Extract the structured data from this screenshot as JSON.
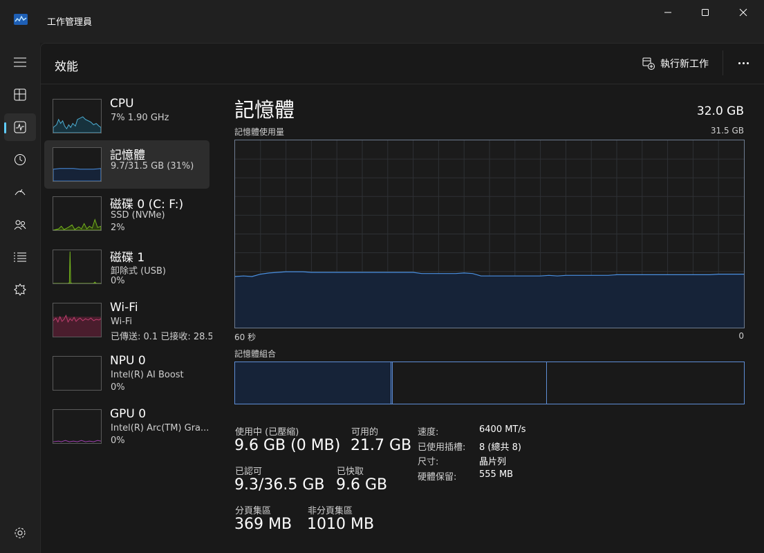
{
  "window": {
    "title": "工作管理員"
  },
  "header": {
    "title": "效能",
    "run_task_label": "執行新工作"
  },
  "nav": {
    "items": [
      {
        "name": "menu",
        "icon": "hamburger-icon"
      },
      {
        "name": "processes",
        "icon": "processes-icon"
      },
      {
        "name": "performance",
        "icon": "performance-icon",
        "active": true
      },
      {
        "name": "app-history",
        "icon": "history-icon"
      },
      {
        "name": "startup-apps",
        "icon": "startup-icon"
      },
      {
        "name": "users",
        "icon": "users-icon"
      },
      {
        "name": "details",
        "icon": "details-icon"
      },
      {
        "name": "services",
        "icon": "services-icon"
      },
      {
        "name": "settings",
        "icon": "settings-icon"
      }
    ]
  },
  "resources": [
    {
      "name": "CPU",
      "line1": "7%  1.90 GHz",
      "line2": "",
      "color": "#4fb3d9"
    },
    {
      "name": "記憶體",
      "line1": "9.7/31.5 GB (31%)",
      "line2": "",
      "color": "#4a7ebf",
      "selected": true
    },
    {
      "name": "磁碟 0 (C: F:)",
      "line1": "SSD (NVMe)",
      "line2": "2%",
      "color": "#77b81e"
    },
    {
      "name": "磁碟 1",
      "line1": "卸除式 (USB)",
      "line2": "0%",
      "color": "#77b81e"
    },
    {
      "name": "Wi-Fi",
      "line1": "Wi-Fi",
      "line2": "已傳送: 0.1  已接收: 28.5",
      "color": "#c04070"
    },
    {
      "name": "NPU 0",
      "line1": "Intel(R) AI Boost",
      "line2": "0%",
      "color": "#4fb3d9"
    },
    {
      "name": "GPU 0",
      "line1": "Intel(R) Arc(TM) Gra...",
      "line2": "0%",
      "color": "#a040b0"
    }
  ],
  "detail": {
    "title": "記憶體",
    "total": "32.0 GB",
    "usage_label": "記憶體使用量",
    "usage_max": "31.5 GB",
    "axis_left": "60 秒",
    "axis_right": "0",
    "composition_label": "記憶體組合",
    "usage_history_gb": [
      8.6,
      8.7,
      8.6,
      9.0,
      9.2,
      9.3,
      9.4,
      9.4,
      9.4,
      9.3,
      9.3,
      9.3,
      9.3,
      9.3,
      9.3,
      9.3,
      9.3,
      9.3,
      9.3,
      9.3,
      9.3,
      9.3,
      9.1,
      9.1,
      9.1,
      9.1,
      9.1,
      9.2,
      9.1,
      8.7,
      8.7,
      8.7,
      8.7,
      8.7,
      8.7,
      8.7,
      8.7,
      8.8,
      8.7,
      8.8,
      8.8,
      8.8,
      8.8,
      8.8,
      8.8,
      8.9,
      8.9,
      8.9,
      8.9,
      8.9,
      8.9,
      8.9,
      8.9,
      8.9,
      8.9,
      8.9,
      8.9,
      9.0,
      9.0,
      9.0,
      9.0
    ],
    "graph_max_gb": 31.5,
    "stats": {
      "in_use_label": "使用中 (已壓縮)",
      "in_use_value": "9.6 GB (0 MB)",
      "available_label": "可用的",
      "available_value": "21.7 GB",
      "committed_label": "已認可",
      "committed_value": "9.3/36.5 GB",
      "cached_label": "已快取",
      "cached_value": "9.6 GB",
      "paged_label": "分頁集區",
      "paged_value": "369 MB",
      "nonpaged_label": "非分頁集區",
      "nonpaged_value": "1010 MB"
    },
    "specs": [
      {
        "label": "速度:",
        "value": "6400 MT/s"
      },
      {
        "label": "已使用插槽:",
        "value": "8 (總共 8)"
      },
      {
        "label": "尺寸:",
        "value": "晶片列"
      },
      {
        "label": "硬體保留:",
        "value": "555 MB"
      }
    ]
  },
  "colors": {
    "accent": "#60cdff",
    "memory_line": "#4a90e2",
    "memory_fill": "#162338"
  }
}
